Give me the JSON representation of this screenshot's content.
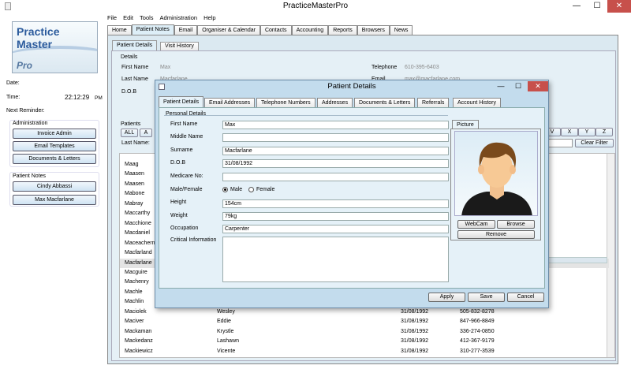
{
  "window": {
    "title": "PracticeMasterPro",
    "minimize": "—",
    "maximize": "☐",
    "close": "✕"
  },
  "menu": [
    "File",
    "Edit",
    "Tools",
    "Administration",
    "Help"
  ],
  "logo": {
    "line1": "Practice Master",
    "line2": "Pro"
  },
  "left": {
    "date_label": "Date:",
    "time_label": "Time:",
    "time_value": "22:12:29",
    "time_ampm": "PM",
    "reminder_label": "Next Reminder:",
    "admin_title": "Administration",
    "admin_buttons": [
      "Invoice Admin",
      "Email Templates",
      "Documents & Letters"
    ],
    "notes_title": "Patient Notes",
    "notes_buttons": [
      "Cindy Abbassi",
      "Max Macfarlane"
    ]
  },
  "main_tabs": [
    "Home",
    "Patient Notes",
    "Email",
    "Organiser & Calendar",
    "Contacts",
    "Accounting",
    "Reports",
    "Browsers",
    "News"
  ],
  "sub_tabs": [
    "Patient Details",
    "Visit History"
  ],
  "details": {
    "title": "Details",
    "first_name_label": "First Name",
    "first_name": "Max",
    "last_name_label": "Last Name",
    "last_name": "Macfarlane",
    "dob_label": "D.O.B",
    "telephone_label": "Telephone",
    "telephone": "610-395-6403",
    "email_label": "Email",
    "email": "max@macfarlane.com"
  },
  "patients": {
    "title": "Patients",
    "all_btn": "ALL",
    "a_btn": "A",
    "alpha_right": [
      "V",
      "X",
      "Y",
      "Z"
    ],
    "last_name_label": "Last Name:",
    "clear_filter": "Clear Filter",
    "rows": [
      {
        "last": "Maag"
      },
      {
        "last": "Maasen"
      },
      {
        "last": "Maasen"
      },
      {
        "last": "Mabone"
      },
      {
        "last": "Mabray"
      },
      {
        "last": "Maccarthy"
      },
      {
        "last": "Macchione"
      },
      {
        "last": "Macdaniel"
      },
      {
        "last": "Maceachern"
      },
      {
        "last": "Macfarland"
      },
      {
        "last": "Macfarlane"
      },
      {
        "last": "Macguire"
      },
      {
        "last": "Machenry"
      },
      {
        "last": "Machle"
      },
      {
        "last": "Machlin"
      },
      {
        "last": "Maciolek",
        "first": "Wesley",
        "dob": "31/08/1992",
        "phone": "505-832-8278"
      },
      {
        "last": "Maciver",
        "first": "Eddie",
        "dob": "31/08/1992",
        "phone": "847-966-8849"
      },
      {
        "last": "Mackaman",
        "first": "Krystle",
        "dob": "31/08/1992",
        "phone": "336-274-0850"
      },
      {
        "last": "Mackedanz",
        "first": "Lashawn",
        "dob": "31/08/1992",
        "phone": "412-367-9179"
      },
      {
        "last": "Mackiewicz",
        "first": "Vicente",
        "dob": "31/08/1992",
        "phone": "310-277-3539"
      }
    ]
  },
  "dialog": {
    "title": "Patient Details",
    "tabs": [
      "Patient Details",
      "Email Addresses",
      "Telephone Numbers",
      "Addresses",
      "Documents & Letters",
      "Referrals",
      "Account History"
    ],
    "section": "Personal Details",
    "first_name_label": "First Name",
    "first_name": "Max",
    "middle_name_label": "Middle Name",
    "middle_name": "",
    "surname_label": "Surname",
    "surname": "Macfarlane",
    "dob_label": "D.O.B",
    "dob": "31/08/1992",
    "medicare_label": "Medicare No:",
    "medicare": "",
    "gender_label": "Male/Female",
    "male": "Male",
    "female": "Female",
    "height_label": "Height",
    "height": "154cm",
    "weight_label": "Weight",
    "weight": "79kg",
    "occupation_label": "Occupation",
    "occupation": "Carpenter",
    "critical_label": "Critical Information",
    "critical": "",
    "picture_tab": "Picture",
    "webcam": "WebCam",
    "browse": "Browse",
    "remove": "Remove",
    "apply": "Apply",
    "save": "Save",
    "cancel": "Cancel"
  }
}
